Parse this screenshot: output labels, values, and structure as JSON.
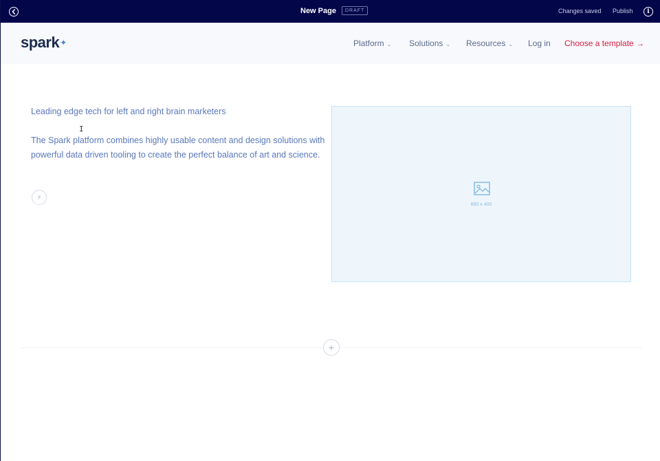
{
  "editor": {
    "page_title": "New Page",
    "status_badge": "DRAFT",
    "save_status": "Changes saved",
    "publish_label": "Publish",
    "back_icon": "back-arrow-circle-icon",
    "info_icon": "info-circle-icon",
    "info_glyph": "i"
  },
  "site_nav": {
    "logo_text": "spark",
    "logo_mark": "✦",
    "items": [
      {
        "label": "Platform",
        "chevron": "⌄"
      },
      {
        "label": "Solutions",
        "chevron": "⌄"
      },
      {
        "label": "Resources",
        "chevron": "⌄"
      },
      {
        "label": "Log in"
      }
    ],
    "cta_label": "Choose a template →"
  },
  "hero": {
    "heading": "Leading edge tech for left and right brain marketers",
    "body": "The Spark platform combines highly usable content and design solutions with powerful data driven tooling to create the perfect balance of art and science.",
    "image_placeholder_label": "680 x 400",
    "add_block_glyph": "⚡"
  },
  "section_add_glyph": "+",
  "colors": {
    "top_bar": "#04064a",
    "accent_link": "#d32045",
    "body_text": "#5a78bd",
    "placeholder_bg": "#eef6fc"
  }
}
